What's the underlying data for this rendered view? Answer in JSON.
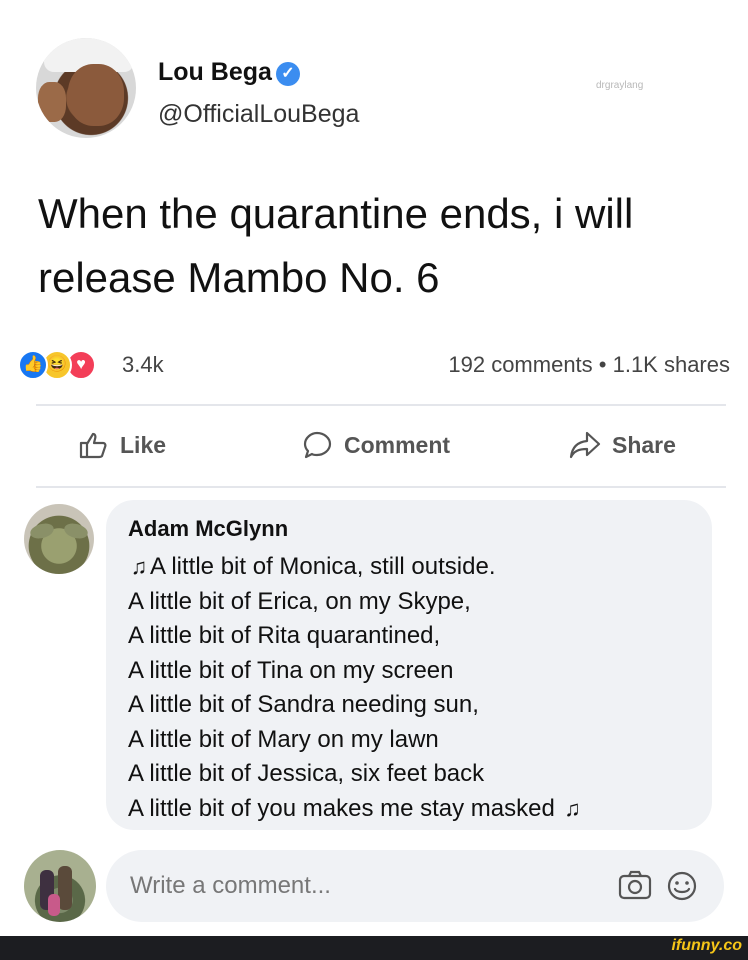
{
  "post": {
    "author_name": "Lou Bega",
    "author_handle": "@OfficialLouBega",
    "watermark": "drgraylang",
    "text_line1": "When the quarantine ends, i will",
    "text_line2": "release Mambo No. 6"
  },
  "stats": {
    "reaction_count": "3.4k",
    "comments_shares": "192 comments • 1.1K shares",
    "reaction_icons": [
      "like-icon",
      "haha-icon",
      "love-icon"
    ]
  },
  "actions": {
    "like": "Like",
    "comment": "Comment",
    "share": "Share"
  },
  "comment": {
    "author": "Adam McGlynn",
    "lines": [
      "A little bit of Monica, still outside.",
      "A little bit of Erica, on my Skype,",
      "A little bit of Rita quarantined,",
      "A little bit of Tina on my screen",
      "A little bit of Sandra needing sun,",
      "A little bit of Mary on my lawn",
      "A little bit of Jessica, six feet back",
      "A little bit of you makes me stay masked"
    ]
  },
  "write_comment": {
    "placeholder": "Write a comment..."
  },
  "footer": {
    "brand": "ifunny.co"
  },
  "colors": {
    "like_blue": "#1877f2",
    "love_red": "#f33e58",
    "haha_yellow": "#f7c62b",
    "bubble_gray": "#f0f2f5",
    "footer_bg": "#1c1d21",
    "footer_brand": "#f5c518"
  }
}
